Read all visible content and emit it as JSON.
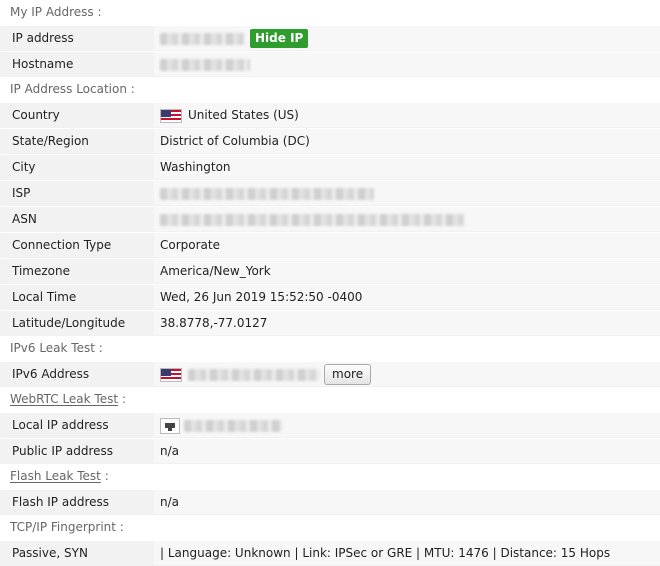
{
  "sections": {
    "my_ip": "My IP Address :",
    "location": "IP Address Location :",
    "ipv6": "IPv6 Leak Test :",
    "webrtc": "WebRTC Leak Test",
    "flash": "Flash Leak Test",
    "tcpip": "TCP/IP Fingerprint :",
    "colon": " :"
  },
  "my_ip": {
    "ip_label": "IP address",
    "hide_ip_label": "Hide IP",
    "hostname_label": "Hostname"
  },
  "location": {
    "country_label": "Country",
    "country_value": "United States (US)",
    "country_flag_icon": "us-flag-icon",
    "state_label": "State/Region",
    "state_value": "District of Columbia (DC)",
    "city_label": "City",
    "city_value": "Washington",
    "isp_label": "ISP",
    "asn_label": "ASN",
    "conn_label": "Connection Type",
    "conn_value": "Corporate",
    "tz_label": "Timezone",
    "tz_value": "America/New_York",
    "time_label": "Local Time",
    "time_value": "Wed, 26 Jun 2019 15:52:50 -0400",
    "latlon_label": "Latitude/Longitude",
    "latlon_value": "38.8778,-77.0127"
  },
  "ipv6": {
    "addr_label": "IPv6 Address",
    "more_label": "more"
  },
  "webrtc": {
    "local_label": "Local IP address",
    "public_label": "Public IP address",
    "public_value": "n/a"
  },
  "flash": {
    "ip_label": "Flash IP address",
    "ip_value": "n/a"
  },
  "tcpip": {
    "label": "Passive, SYN",
    "value": "| Language: Unknown | Link: IPSec or GRE | MTU: 1476 | Distance: 15 Hops"
  },
  "colors": {
    "hide_button": "#2e9d2e",
    "row_bg": "#f2f2f2",
    "section_text": "#666666"
  }
}
